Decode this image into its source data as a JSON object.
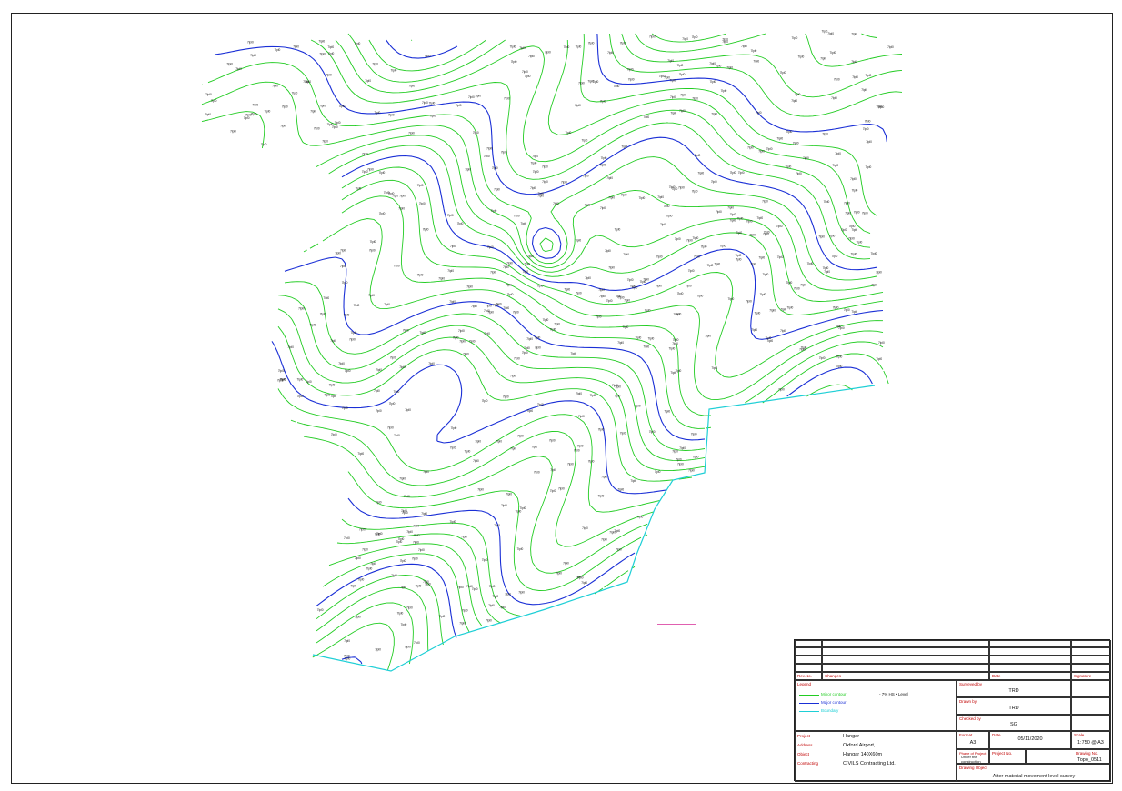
{
  "map": {
    "colors": {
      "minor": "#22cc22",
      "major": "#1a2fd6",
      "boundary": "#1ecfd6",
      "label": "#111111"
    },
    "spot_label": "7lpl0"
  },
  "title_block": {
    "revision_header": {
      "no": "Rev.No.",
      "changes": "Changes",
      "date": "Date",
      "signature": "Signature"
    },
    "legend": {
      "title": "Legend",
      "items": [
        {
          "label": "Minor contour",
          "color": "#22cc22"
        },
        {
          "label": "Major contour",
          "color": "#1a2fd6"
        },
        {
          "label": "Boundary",
          "color": "#1ecfd6"
        }
      ],
      "note": "- 7% HS • Level"
    },
    "surveyed_by": {
      "label": "Surveyed by",
      "value": "TRD"
    },
    "drawn_by": {
      "label": "Drawn by",
      "value": "TRD"
    },
    "checked_by": {
      "label": "Checked by",
      "value": "SG"
    },
    "project": {
      "label": "Project",
      "value": "Hangar"
    },
    "address": {
      "label": "Address",
      "value": "Oxford Airport,"
    },
    "object": {
      "label": "Object",
      "value": "Hangar 140X60m"
    },
    "contracting": {
      "label": "Contracting",
      "value": "CIVILS Contracting Ltd."
    },
    "format": {
      "label": "Format",
      "value": "A3"
    },
    "date": {
      "label": "Date",
      "value": "05/11/2020"
    },
    "scale": {
      "label": "Scale",
      "value": "1:750 @ A3"
    },
    "phase": {
      "label": "Phase of Project",
      "value": "Under the construction"
    },
    "project_no": {
      "label": "Project No.",
      "value": ""
    },
    "drawing_no": {
      "label": "Drawing No.",
      "value": "Topo_0511"
    },
    "drawing_object": {
      "label": "Drawing Object",
      "value": "After material movement level survey"
    }
  }
}
